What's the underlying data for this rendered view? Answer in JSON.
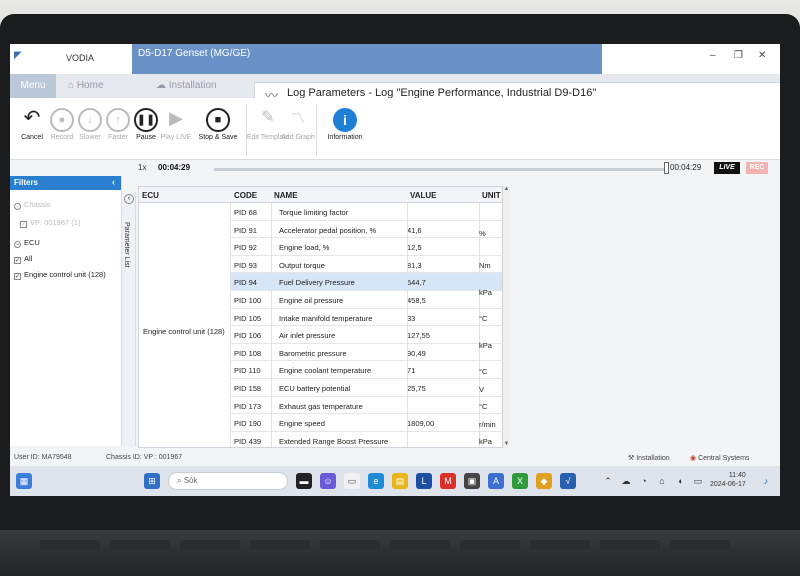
{
  "window": {
    "app_name": "VODIA",
    "context_title": "D5-D17 Genset (MG/GE)"
  },
  "nav": {
    "menu": "Menu",
    "home": "Home",
    "installation": "Installation",
    "active_tab": "Log Parameters - Log \"Engine Performance, Industrial D9-D16\""
  },
  "toolbar": {
    "cancel": "Cancel",
    "record": "Record",
    "slower": "Slower",
    "faster": "Faster",
    "pause": "Pause",
    "play_live": "Play LIVE",
    "stop_save": "Stop & Save",
    "edit_template": "Edit Template",
    "add_graph": "Add Graph",
    "information": "Information"
  },
  "timeline": {
    "speed": "1x",
    "current": "00:04:29",
    "end": "00:04:29",
    "live": "LIVE",
    "rec": "REC"
  },
  "filters": {
    "title": "Filters",
    "chassis": "Chassis",
    "vin": "VP: 001967 (1)",
    "ecu": "ECU",
    "all": "All",
    "engine_unit": "Engine control unit (128)"
  },
  "param_list_label": "Parameter List",
  "table": {
    "headers": {
      "ecu": "ECU",
      "code": "CODE",
      "name": "NAME",
      "value": "VALUE",
      "unit": "UNIT"
    },
    "ecu_name": "Engine control unit (128)",
    "rows": [
      {
        "code": "PID 68",
        "name": "Torque limiting factor",
        "value": ""
      },
      {
        "code": "PID 91",
        "name": "Accelerator pedal position, %",
        "value": "41,6"
      },
      {
        "code": "PID 92",
        "name": "Engine load, %",
        "value": "12,5"
      },
      {
        "code": "PID 93",
        "name": "Output torque",
        "value": "81,3"
      },
      {
        "code": "PID 94",
        "name": "Fuel Delivery Pressure",
        "value": "544,7"
      },
      {
        "code": "PID 100",
        "name": "Engine oil pressure",
        "value": "458,5"
      },
      {
        "code": "PID 105",
        "name": "Intake manifold temperature",
        "value": "33"
      },
      {
        "code": "PID 106",
        "name": "Air inlet pressure",
        "value": "127,55"
      },
      {
        "code": "PID 108",
        "name": "Barometric pressure",
        "value": "90,49"
      },
      {
        "code": "PID 110",
        "name": "Engine coolant temperature",
        "value": "71"
      },
      {
        "code": "PID 158",
        "name": "ECU battery potential",
        "value": "25,75"
      },
      {
        "code": "PID 173",
        "name": "Exhaust gas temperature",
        "value": ""
      },
      {
        "code": "PID 190",
        "name": "Engine speed",
        "value": "1809,00"
      },
      {
        "code": "PID 439",
        "name": "Extended Range Boost Pressure",
        "value": ""
      }
    ],
    "units": {
      "u1": "%",
      "u2": "Nm",
      "u3": "kPa",
      "u4": "°C",
      "u5": "kPa",
      "u6": "°C",
      "u7": "V",
      "u8": "°C",
      "u9": "r/min",
      "u10": "kPa"
    }
  },
  "status": {
    "user": "User ID: MA79548",
    "chassis": "Chassis ID: VP : 001967",
    "installation": "Installation",
    "central": "Central Systems"
  },
  "taskbar": {
    "search": "Sök",
    "time": "11:40",
    "date": "2024-06-17"
  }
}
